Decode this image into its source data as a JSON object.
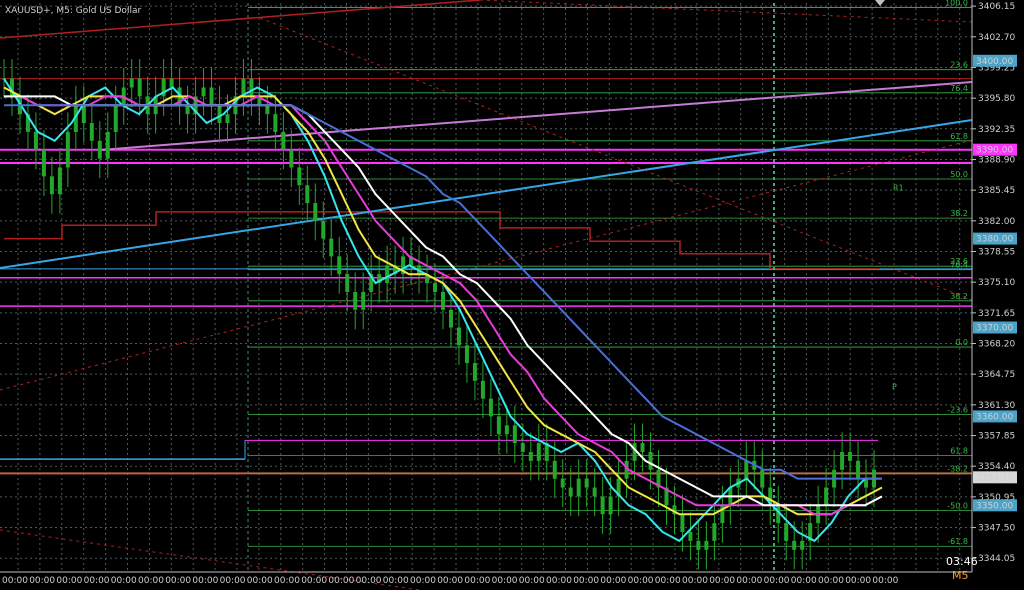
{
  "window": {
    "symbol_label": "XAUUSD+, M5: Gold US Dollar",
    "timer": "03:46",
    "timeframe": "M5"
  },
  "colors": {
    "bg": "#000000",
    "grid": "#4d5a5a",
    "candle": "#22a82a",
    "ma_cyan": "#35e6ef",
    "ma_yellow": "#f2e646",
    "ma_magenta": "#e83bd9",
    "ma_white": "#ffffff",
    "ma_blue": "#4a6fd6",
    "trend_blue": "#36a7e6",
    "trend_violet": "#c77ad6",
    "level_magenta": "#ff33ff",
    "level_red": "#b02020",
    "fib_green": "#3cb44b"
  },
  "chart_data": {
    "type": "candlestick",
    "title": "XAUUSD+, M5: Gold US Dollar",
    "ylim": [
      3342.5,
      3406.5
    ],
    "y_ticks": [
      "3406.15",
      "3402.70",
      "3399.25",
      "3395.80",
      "3392.35",
      "3388.90",
      "3385.45",
      "3382.00",
      "3378.55",
      "3375.10",
      "3371.65",
      "3368.20",
      "3364.75",
      "3361.30",
      "3357.85",
      "3354.40",
      "3350.95",
      "3347.50",
      "3344.05"
    ],
    "x_tick_labels": [
      "00:00",
      "00:00",
      "00:00",
      "00:00",
      "00:00",
      "00:00",
      "00:00",
      "00:00",
      "00:00",
      "00:00",
      "00:00",
      "00:00",
      "00:00",
      "00:00",
      "00:00",
      "00:00",
      "00:00",
      "00:00",
      "00:00",
      "00:00",
      "00:00",
      "00:00",
      "00:00",
      "00:00",
      "00:00",
      "00:00",
      "00:00",
      "00:00",
      "00:00",
      "00:00",
      "00:00",
      "00:00",
      "00:00"
    ],
    "price_boxes": [
      {
        "label": "3400.00",
        "value": 3400.0,
        "color": "#4aa3c8"
      },
      {
        "label": "3390.00",
        "value": 3390.0,
        "color": "#ff33ff"
      },
      {
        "label": "3380.00",
        "value": 3380.0,
        "color": "#4aa3c8"
      },
      {
        "label": "3370.00",
        "value": 3370.0,
        "color": "#4aa3c8"
      },
      {
        "label": "3360.00",
        "value": 3360.0,
        "color": "#4aa3c8"
      },
      {
        "label": "3353.15",
        "value": 3353.15,
        "color": "#d8d8d8"
      },
      {
        "label": "3350.00",
        "value": 3350.0,
        "color": "#4aa3c8"
      }
    ],
    "fib_top": [
      {
        "label": "100.0",
        "value": 3406.0
      },
      {
        "label": "23.6",
        "value": 3399.0
      },
      {
        "label": "76.4",
        "value": 3396.4
      },
      {
        "label": "61.8",
        "value": 3391.0
      },
      {
        "label": "50.0",
        "value": 3386.7
      },
      {
        "label": "38.2",
        "value": 3382.3
      },
      {
        "label": "23.6",
        "value": 3376.9
      },
      {
        "label": "76.4",
        "value": 3376.5
      },
      {
        "label": "38.2",
        "value": 3373.0
      },
      {
        "label": "0.0",
        "value": 3367.8
      }
    ],
    "fib_bottom": [
      {
        "label": "-23.6",
        "value": 3360.2
      },
      {
        "label": "61.8",
        "value": 3355.6
      },
      {
        "label": "-38.2",
        "value": 3353.6
      },
      {
        "label": "-50.0",
        "value": 3349.4
      },
      {
        "label": "-61.8",
        "value": 3345.4
      }
    ],
    "pivots": [
      {
        "label": "R1",
        "value": 3385.4
      },
      {
        "label": "P",
        "value": 3363.0
      }
    ],
    "close": [
      3398,
      3396,
      3394,
      3392,
      3390,
      3387,
      3385,
      3388,
      3392,
      3395,
      3393,
      3391,
      3389,
      3392,
      3395,
      3397,
      3398,
      3396,
      3394,
      3396,
      3398,
      3397,
      3395,
      3394,
      3396,
      3397,
      3395,
      3393,
      3394,
      3396,
      3398,
      3396,
      3395,
      3394,
      3392,
      3390,
      3388,
      3386,
      3384,
      3382,
      3380,
      3378,
      3376,
      3374,
      3372,
      3374,
      3376,
      3375,
      3377,
      3376,
      3378,
      3377,
      3376,
      3375,
      3374,
      3372,
      3370,
      3368,
      3366,
      3364,
      3362,
      3360,
      3358,
      3359,
      3357,
      3356,
      3355,
      3357,
      3355,
      3353,
      3352,
      3351,
      3353,
      3352,
      3351,
      3349,
      3351,
      3353,
      3355,
      3357,
      3356,
      3354,
      3352,
      3350,
      3349,
      3347,
      3346,
      3345,
      3346,
      3348,
      3350,
      3352,
      3353,
      3355,
      3354,
      3352,
      3350,
      3348,
      3346,
      3345,
      3346,
      3348,
      3350,
      3352,
      3354,
      3356,
      3355,
      3353,
      3352,
      3354
    ],
    "series": [
      {
        "name": "",
        "color": "#35e6ef",
        "values": [
          3398,
          3395,
          3392,
          3391,
          3393,
          3396,
          3397,
          3395,
          3394,
          3396,
          3397,
          3395,
          3393,
          3394,
          3396,
          3397,
          3396,
          3394,
          3391,
          3387,
          3382,
          3378,
          3375,
          3376,
          3377,
          3376,
          3375,
          3372,
          3368,
          3364,
          3360,
          3358,
          3357,
          3356,
          3357,
          3355,
          3352,
          3350,
          3349,
          3347,
          3346,
          3348,
          3350,
          3352,
          3353,
          3351,
          3349,
          3347,
          3346,
          3348,
          3351,
          3353,
          3353
        ]
      },
      {
        "name": "",
        "color": "#f2e646",
        "values": [
          3397,
          3396,
          3395,
          3394,
          3395,
          3396,
          3396,
          3396,
          3395,
          3395,
          3396,
          3396,
          3395,
          3395,
          3396,
          3396,
          3396,
          3394,
          3392,
          3389,
          3385,
          3381,
          3378,
          3377,
          3376,
          3376,
          3375,
          3373,
          3370,
          3367,
          3364,
          3361,
          3359,
          3358,
          3357,
          3356,
          3354,
          3352,
          3351,
          3350,
          3349,
          3349,
          3349,
          3350,
          3351,
          3351,
          3350,
          3349,
          3349,
          3349,
          3350,
          3351,
          3352
        ]
      },
      {
        "name": "",
        "color": "#e83bd9",
        "values": [
          3396,
          3396,
          3395,
          3395,
          3395,
          3395,
          3396,
          3396,
          3395,
          3395,
          3395,
          3396,
          3395,
          3395,
          3395,
          3396,
          3395,
          3395,
          3393,
          3391,
          3388,
          3385,
          3382,
          3380,
          3378,
          3377,
          3376,
          3375,
          3373,
          3370,
          3367,
          3365,
          3362,
          3360,
          3358,
          3357,
          3356,
          3354,
          3353,
          3352,
          3351,
          3350,
          3350,
          3350,
          3350,
          3350,
          3350,
          3350,
          3349,
          3349,
          3350,
          3350,
          3351
        ]
      },
      {
        "name": "",
        "color": "#ffffff",
        "values": [
          3396,
          3396,
          3396,
          3396,
          3395,
          3395,
          3395,
          3395,
          3395,
          3395,
          3395,
          3395,
          3395,
          3395,
          3395,
          3395,
          3395,
          3395,
          3394,
          3392,
          3390,
          3388,
          3385,
          3383,
          3381,
          3379,
          3378,
          3376,
          3375,
          3373,
          3371,
          3368,
          3366,
          3364,
          3362,
          3360,
          3358,
          3357,
          3355,
          3354,
          3353,
          3352,
          3351,
          3351,
          3351,
          3350,
          3350,
          3350,
          3350,
          3350,
          3350,
          3350,
          3351
        ]
      },
      {
        "name": "",
        "color": "#4a6fd6",
        "values": [
          3395,
          3395,
          3395,
          3395,
          3395,
          3395,
          3395,
          3395,
          3395,
          3395,
          3395,
          3395,
          3395,
          3395,
          3395,
          3395,
          3395,
          3395,
          3394,
          3393,
          3392,
          3391,
          3390,
          3389,
          3388,
          3387,
          3385,
          3384,
          3382,
          3380,
          3378,
          3376,
          3374,
          3372,
          3370,
          3368,
          3366,
          3364,
          3362,
          3360,
          3359,
          3358,
          3357,
          3356,
          3355,
          3354,
          3354,
          3353,
          3353,
          3353,
          3353,
          3353,
          3353
        ]
      }
    ]
  }
}
